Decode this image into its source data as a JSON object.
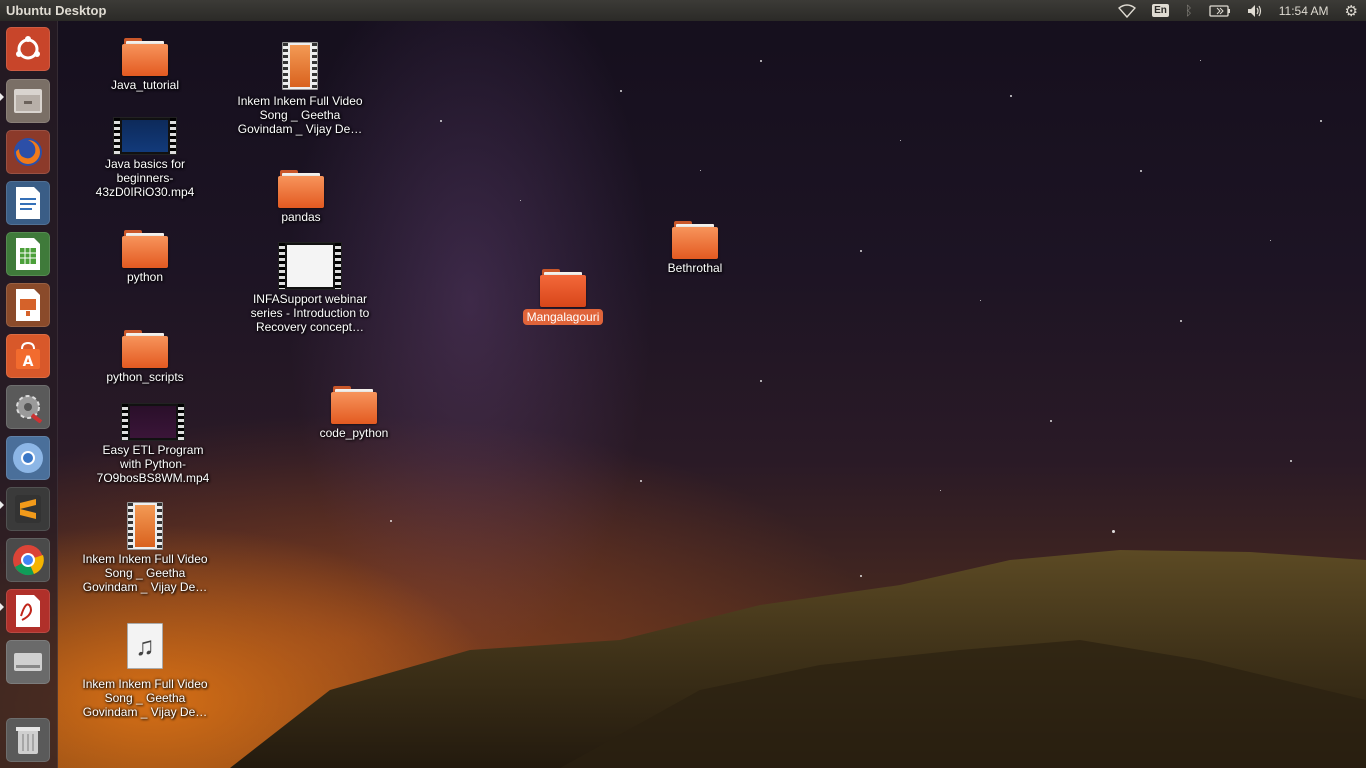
{
  "panel": {
    "title": "Ubuntu Desktop",
    "language": "En",
    "time": "11:54 AM"
  },
  "launcher": {
    "items": [
      {
        "icon": "ubuntu-dash-icon"
      },
      {
        "icon": "files-icon"
      },
      {
        "icon": "firefox-icon"
      },
      {
        "icon": "libreoffice-writer-icon"
      },
      {
        "icon": "libreoffice-calc-icon"
      },
      {
        "icon": "libreoffice-impress-icon"
      },
      {
        "icon": "ubuntu-software-icon"
      },
      {
        "icon": "system-settings-icon"
      },
      {
        "icon": "chromium-icon"
      },
      {
        "icon": "sublime-text-icon"
      },
      {
        "icon": "chrome-icon"
      },
      {
        "icon": "document-viewer-icon"
      },
      {
        "icon": "drive-icon"
      },
      {
        "icon": "trash-icon"
      }
    ]
  },
  "desktop": {
    "icons": [
      {
        "label": "Java_tutorial",
        "type": "folder"
      },
      {
        "label": "Java basics for beginners-43zD0IRiO30.mp4",
        "type": "video"
      },
      {
        "label": "python",
        "type": "folder"
      },
      {
        "label": "python_scripts",
        "type": "folder"
      },
      {
        "label": "Easy ETL Program with Python-7O9bosBS8WM.mp4",
        "type": "video"
      },
      {
        "label": "Inkem Inkem Full Video Song _ Geetha Govindam _ Vijay De…",
        "type": "video-file"
      },
      {
        "label": "Inkem Inkem Full Video Song _ Geetha Govindam _ Vijay De…",
        "type": "audio-file"
      },
      {
        "label": "Inkem Inkem Full Video Song _ Geetha Govindam _ Vijay De…",
        "type": "video-file"
      },
      {
        "label": "pandas",
        "type": "folder"
      },
      {
        "label": "INFASupport webinar series  - Introduction to Recovery concept…",
        "type": "video"
      },
      {
        "label": "code_python",
        "type": "folder"
      },
      {
        "label": "Mangalagouri",
        "type": "folder",
        "selected": true
      },
      {
        "label": "Bethrothal",
        "type": "folder"
      }
    ]
  }
}
